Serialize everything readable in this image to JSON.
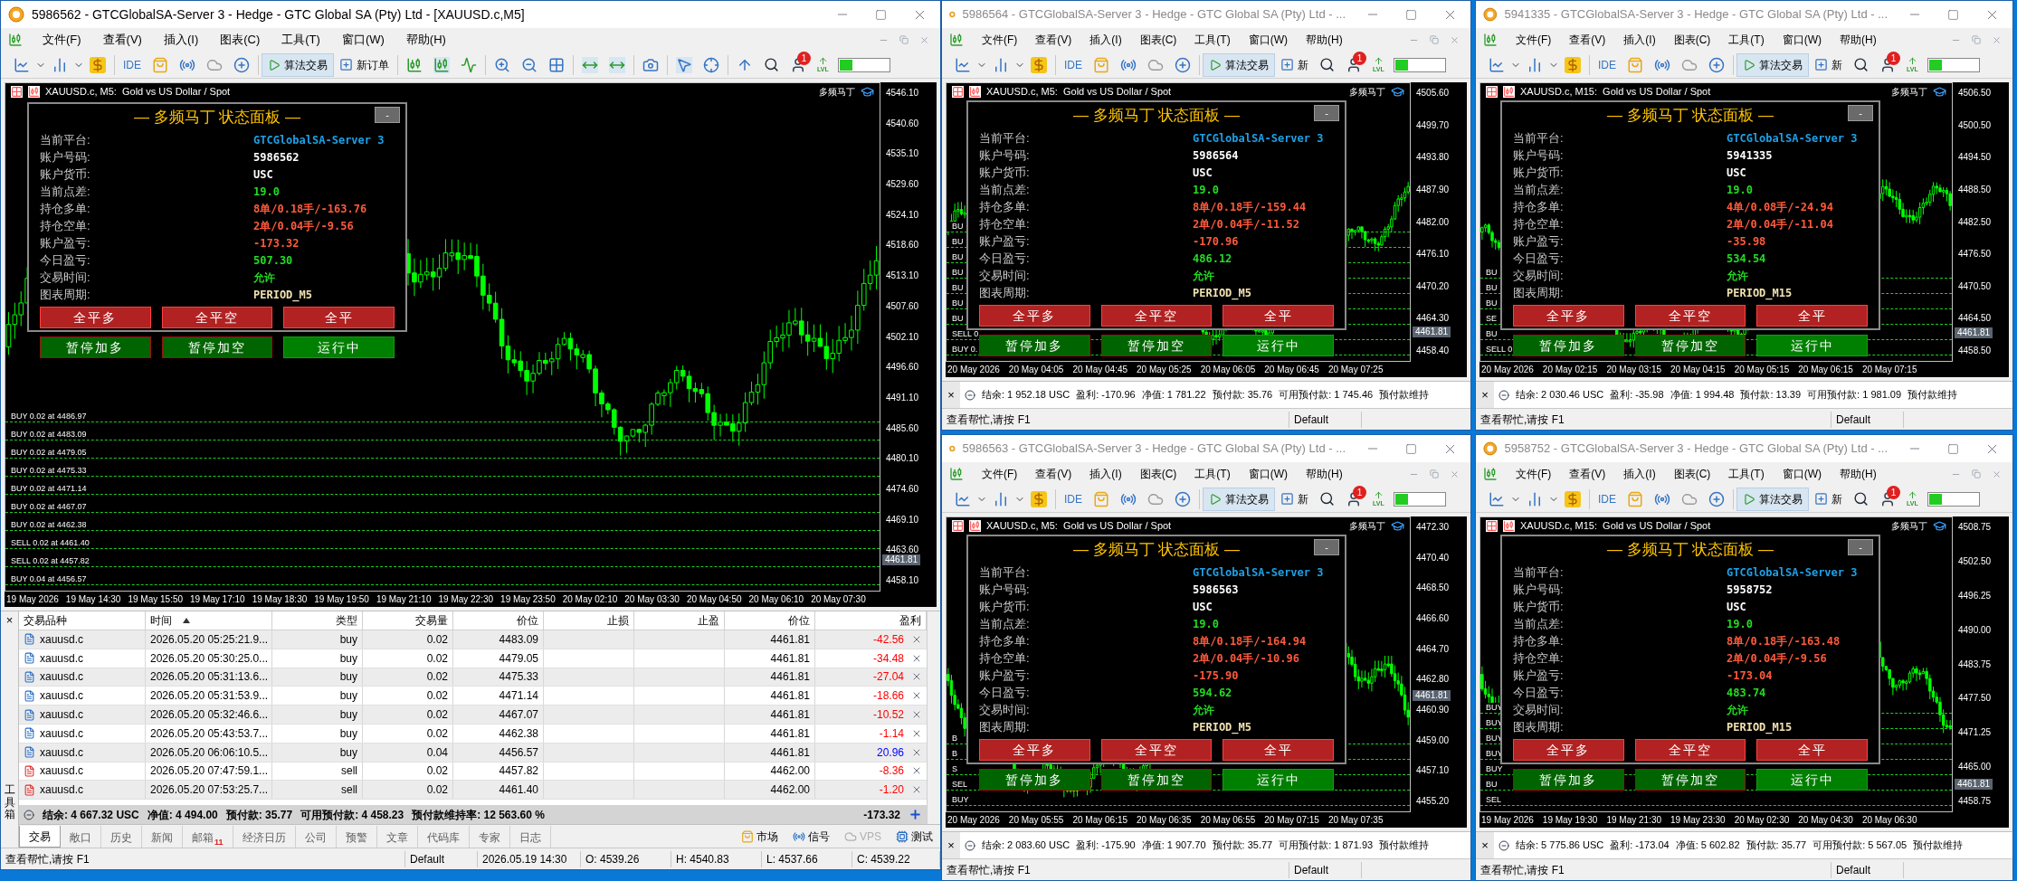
{
  "windows": [
    {
      "kind": "main",
      "active": true,
      "title": "5986562 - GTCGlobalSA-Server 3 - Hedge - GTC Global SA (Pty) Ltd - [XAUUSD.c,M5]",
      "menu": [
        "文件(F)",
        "查看(V)",
        "插入(I)",
        "图表(C)",
        "工具(T)",
        "窗口(W)",
        "帮助(H)"
      ],
      "toolbar": {
        "ide": "IDE",
        "algo_trading": {
          "label": "算法交易",
          "on": true
        },
        "new_order": "新订单",
        "badge": "1",
        "lvl": "LVL"
      },
      "chart": {
        "header": "XAUUSD.c, M5:  Gold vs US Dollar / Spot",
        "indicator": "多频马丁",
        "price_axis": [
          "4546.10",
          "4540.60",
          "4535.10",
          "4529.60",
          "4524.10",
          "4518.60",
          "4513.10",
          "4507.60",
          "4502.10",
          "4496.60",
          "4491.10",
          "4485.60",
          "4480.10",
          "4474.60",
          "4469.10",
          "4463.60",
          "4458.10"
        ],
        "current_price": "4461.81",
        "time_axis": [
          "19 May 2026",
          "19 May 14:30",
          "19 May 15:50",
          "19 May 17:10",
          "19 May 18:30",
          "19 May 19:50",
          "19 May 21:10",
          "19 May 22:30",
          "19 May 23:50",
          "20 May 02:10",
          "20 May 03:30",
          "20 May 04:50",
          "20 May 06:10",
          "20 May 07:30"
        ],
        "order_lines": [
          "BUY 0.02 at 4486.97",
          "BUY 0.02 at 4483.09",
          "BUY 0.02 at 4479.05",
          "BUY 0.02 at 4475.33",
          "BUY 0.02 at 4471.14",
          "BUY 0.02 at 4467.07",
          "BUY 0.02 at 4462.38",
          "SELL 0.02 at 4461.40",
          "SELL 0.02 at 4457.82",
          "BUY 0.04 at 4456.57"
        ],
        "panel": {
          "title": "— 多频马丁 状态面板 —",
          "minimize": "-",
          "rows": [
            {
              "label": "当前平台:",
              "value": "GTCGlobalSA-Server 3",
              "color": "#1ea0e6"
            },
            {
              "label": "账户号码:",
              "value": "5986562",
              "color": "#ffffff"
            },
            {
              "label": "账户货币:",
              "value": "USC",
              "color": "#ffffff"
            },
            {
              "label": "当前点差:",
              "value": "19.0",
              "color": "#22dd22"
            },
            {
              "label": "持仓多单:",
              "value": "8单/0.18手/-163.76",
              "color": "#ff5a3c"
            },
            {
              "label": "持仓空单:",
              "value": "2单/0.04手/-9.56",
              "color": "#ff5a3c"
            },
            {
              "label": "账户盈亏:",
              "value": "-173.32",
              "color": "#ff5a3c"
            },
            {
              "label": "今日盈亏:",
              "value": "507.30",
              "color": "#22dd22"
            },
            {
              "label": "交易时间:",
              "value": "允许",
              "color": "#22dd22"
            },
            {
              "label": "图表周期:",
              "value": "PERIOD_M5",
              "color": "#f2e2b0"
            }
          ],
          "buttons": [
            {
              "label": "全平多",
              "kind": "close"
            },
            {
              "label": "全平空",
              "kind": "close"
            },
            {
              "label": "全平",
              "kind": "close"
            },
            {
              "label": "暂停加多",
              "kind": "pause"
            },
            {
              "label": "暂停加空",
              "kind": "pause"
            },
            {
              "label": "运行中",
              "kind": "running"
            }
          ]
        }
      },
      "toolbox": {
        "side_label": "工具箱",
        "close": "×",
        "columns": [
          {
            "label": "交易品种",
            "sorted": false
          },
          {
            "label": "时间",
            "sorted": true
          },
          {
            "label": "类型",
            "sorted": false
          },
          {
            "label": "交易量",
            "sorted": false
          },
          {
            "label": "价位",
            "sorted": false
          },
          {
            "label": "止损",
            "sorted": false
          },
          {
            "label": "止盈",
            "sorted": false
          },
          {
            "label": "价位",
            "sorted": false
          },
          {
            "label": "盈利",
            "sorted": false
          }
        ],
        "rows": [
          {
            "kind": "buy",
            "cells": [
              "xauusd.c",
              "2026.05.20 05:25:21.9...",
              "buy",
              "0.02",
              "4483.09",
              "",
              "",
              "4461.81",
              "-42.56"
            ],
            "color": "#ff0000"
          },
          {
            "kind": "buy",
            "cells": [
              "xauusd.c",
              "2026.05.20 05:30:25.0...",
              "buy",
              "0.02",
              "4479.05",
              "",
              "",
              "4461.81",
              "-34.48"
            ],
            "color": "#ff0000"
          },
          {
            "kind": "buy",
            "cells": [
              "xauusd.c",
              "2026.05.20 05:31:13.6...",
              "buy",
              "0.02",
              "4475.33",
              "",
              "",
              "4461.81",
              "-27.04"
            ],
            "color": "#ff0000"
          },
          {
            "kind": "buy",
            "cells": [
              "xauusd.c",
              "2026.05.20 05:31:53.9...",
              "buy",
              "0.02",
              "4471.14",
              "",
              "",
              "4461.81",
              "-18.66"
            ],
            "color": "#ff0000"
          },
          {
            "kind": "buy",
            "cells": [
              "xauusd.c",
              "2026.05.20 05:32:46.6...",
              "buy",
              "0.02",
              "4467.07",
              "",
              "",
              "4461.81",
              "-10.52"
            ],
            "color": "#ff0000"
          },
          {
            "kind": "buy",
            "cells": [
              "xauusd.c",
              "2026.05.20 05:43:53.7...",
              "buy",
              "0.02",
              "4462.38",
              "",
              "",
              "4461.81",
              "-1.14"
            ],
            "color": "#ff0000"
          },
          {
            "kind": "buy",
            "cells": [
              "xauusd.c",
              "2026.05.20 06:06:10.5...",
              "buy",
              "0.04",
              "4456.57",
              "",
              "",
              "4461.81",
              "20.96"
            ],
            "color": "#0000ff"
          },
          {
            "kind": "sell",
            "cells": [
              "xauusd.c",
              "2026.05.20 07:47:59.1...",
              "sell",
              "0.02",
              "4457.82",
              "",
              "",
              "4462.00",
              "-8.36"
            ],
            "color": "#ff0000"
          },
          {
            "kind": "sell",
            "cells": [
              "xauusd.c",
              "2026.05.20 07:53:25.7...",
              "sell",
              "0.02",
              "4461.40",
              "",
              "",
              "4462.00",
              "-1.20"
            ],
            "color": "#ff0000"
          }
        ],
        "summary": [
          "结余: 4 667.32 USC",
          "净值: 4 494.00",
          "预付款: 35.77",
          "可用预付款: 4 458.23",
          "预付款维持率: 12 563.60 %"
        ],
        "total": "-173.32",
        "tabs": [
          {
            "label": "交易",
            "selected": true
          },
          {
            "label": "敞口",
            "selected": false
          },
          {
            "label": "历史",
            "selected": false
          },
          {
            "label": "新闻",
            "selected": false
          },
          {
            "label": "邮箱",
            "selected": false,
            "badge": "11"
          },
          {
            "label": "经济日历",
            "selected": false
          },
          {
            "label": "公司",
            "selected": false
          },
          {
            "label": "预警",
            "selected": false
          },
          {
            "label": "文章",
            "selected": false
          },
          {
            "label": "代码库",
            "selected": false
          },
          {
            "label": "专家",
            "selected": false
          },
          {
            "label": "日志",
            "selected": false
          }
        ],
        "services": [
          {
            "label": "市场",
            "kind": "market",
            "disabled": false
          },
          {
            "label": "信号",
            "kind": "signals",
            "disabled": false
          },
          {
            "label": "VPS",
            "kind": "vps",
            "disabled": true
          },
          {
            "label": "测试",
            "kind": "tester",
            "disabled": false
          }
        ]
      },
      "status_bar": [
        "查看帮忙,请按 F1",
        "Default",
        "2026.05.19 14:30",
        "O: 4539.26",
        "H: 4540.83",
        "L: 4537.66",
        "C: 4539.22"
      ]
    },
    {
      "kind": "compact",
      "active": false,
      "title": "5986564 - GTCGlobalSA-Server 3 - Hedge - GTC Global SA (Pty) Ltd - ...",
      "menu": [
        "文件(F)",
        "查看(V)",
        "插入(I)",
        "图表(C)",
        "工具(T)",
        "窗口(W)",
        "帮助(H)"
      ],
      "toolbar": {
        "ide": "IDE",
        "algo_trading": {
          "label": "算法交易",
          "on": true
        },
        "new_order": "新",
        "badge": "1",
        "lvl": "LVL"
      },
      "chart": {
        "header": "XAUUSD.c, M5:  Gold vs US Dollar / Spot",
        "indicator": "多频马丁",
        "price_axis": [
          "4505.60",
          "4499.70",
          "4493.80",
          "4487.90",
          "4482.00",
          "4476.10",
          "4470.20",
          "4464.30",
          "4458.40"
        ],
        "current_price": "4461.81",
        "time_axis": [
          "20 May 2026",
          "20 May 04:05",
          "20 May 04:45",
          "20 May 05:25",
          "20 May 06:05",
          "20 May 06:45",
          "20 May 07:25"
        ],
        "order_lines": [
          "BU",
          "BU",
          "BU",
          "BU",
          "BU",
          "BU",
          "BU",
          "SELL 0.",
          "BUY 0."
        ],
        "panel": {
          "title": "— 多频马丁 状态面板 —",
          "minimize": "-",
          "rows": [
            {
              "label": "当前平台:",
              "value": "GTCGlobalSA-Server 3",
              "color": "#1ea0e6"
            },
            {
              "label": "账户号码:",
              "value": "5986564",
              "color": "#ffffff"
            },
            {
              "label": "账户货币:",
              "value": "USC",
              "color": "#ffffff"
            },
            {
              "label": "当前点差:",
              "value": "19.0",
              "color": "#22dd22"
            },
            {
              "label": "持仓多单:",
              "value": "8单/0.18手/-159.44",
              "color": "#ff5a3c"
            },
            {
              "label": "持仓空单:",
              "value": "2单/0.04手/-11.52",
              "color": "#ff5a3c"
            },
            {
              "label": "账户盈亏:",
              "value": "-170.96",
              "color": "#ff5a3c"
            },
            {
              "label": "今日盈亏:",
              "value": "486.12",
              "color": "#22dd22"
            },
            {
              "label": "交易时间:",
              "value": "允许",
              "color": "#22dd22"
            },
            {
              "label": "图表周期:",
              "value": "PERIOD_M5",
              "color": "#f2e2b0"
            }
          ],
          "buttons": [
            {
              "label": "全平多",
              "kind": "close"
            },
            {
              "label": "全平空",
              "kind": "close"
            },
            {
              "label": "全平",
              "kind": "close"
            },
            {
              "label": "暂停加多",
              "kind": "pause"
            },
            {
              "label": "暂停加空",
              "kind": "pause"
            },
            {
              "label": "运行中",
              "kind": "running"
            }
          ]
        }
      },
      "toolbox": {
        "close": "×",
        "summary": [
          "结余: 1 952.18 USC",
          "盈利: -170.96",
          "净值: 1 781.22",
          "预付款: 35.76",
          "可用预付款: 1 745.46",
          "预付款维持"
        ]
      },
      "status_bar": [
        "查看帮忙,请按 F1",
        "Default"
      ]
    },
    {
      "kind": "compact",
      "active": false,
      "title": "5941335 - GTCGlobalSA-Server 3 - Hedge - GTC Global SA (Pty) Ltd - ...",
      "menu": [
        "文件(F)",
        "查看(V)",
        "插入(I)",
        "图表(C)",
        "工具(T)",
        "窗口(W)",
        "帮助(H)"
      ],
      "toolbar": {
        "ide": "IDE",
        "algo_trading": {
          "label": "算法交易",
          "on": true
        },
        "new_order": "新",
        "badge": "1",
        "lvl": "LVL"
      },
      "chart": {
        "header": "XAUUSD.c, M15:  Gold vs US Dollar / Spot",
        "indicator": "多频马丁",
        "price_axis": [
          "4506.50",
          "4500.50",
          "4494.50",
          "4488.50",
          "4482.50",
          "4476.50",
          "4470.50",
          "4464.50",
          "4458.50"
        ],
        "current_price": "4461.81",
        "time_axis": [
          "20 May 2026",
          "20 May 02:15",
          "20 May 03:15",
          "20 May 04:15",
          "20 May 05:15",
          "20 May 06:15",
          "20 May 07:15"
        ],
        "order_lines": [
          "BU",
          "BU",
          "BU",
          "SE",
          "BU",
          "SELL 0."
        ],
        "panel": {
          "title": "— 多频马丁 状态面板 —",
          "minimize": "-",
          "rows": [
            {
              "label": "当前平台:",
              "value": "GTCGlobalSA-Server 3",
              "color": "#1ea0e6"
            },
            {
              "label": "账户号码:",
              "value": "5941335",
              "color": "#ffffff"
            },
            {
              "label": "账户货币:",
              "value": "USC",
              "color": "#ffffff"
            },
            {
              "label": "当前点差:",
              "value": "19.0",
              "color": "#22dd22"
            },
            {
              "label": "持仓多单:",
              "value": "4单/0.08手/-24.94",
              "color": "#ff5a3c"
            },
            {
              "label": "持仓空单:",
              "value": "2单/0.04手/-11.04",
              "color": "#ff5a3c"
            },
            {
              "label": "账户盈亏:",
              "value": "-35.98",
              "color": "#ff5a3c"
            },
            {
              "label": "今日盈亏:",
              "value": "534.54",
              "color": "#22dd22"
            },
            {
              "label": "交易时间:",
              "value": "允许",
              "color": "#22dd22"
            },
            {
              "label": "图表周期:",
              "value": "PERIOD_M15",
              "color": "#f2e2b0"
            }
          ],
          "buttons": [
            {
              "label": "全平多",
              "kind": "close"
            },
            {
              "label": "全平空",
              "kind": "close"
            },
            {
              "label": "全平",
              "kind": "close"
            },
            {
              "label": "暂停加多",
              "kind": "pause"
            },
            {
              "label": "暂停加空",
              "kind": "pause"
            },
            {
              "label": "运行中",
              "kind": "running"
            }
          ]
        }
      },
      "toolbox": {
        "close": "×",
        "summary": [
          "结余: 2 030.46 USC",
          "盈利: -35.98",
          "净值: 1 994.48",
          "预付款: 13.39",
          "可用预付款: 1 981.09",
          "预付款维持"
        ]
      },
      "status_bar": [
        "查看帮忙,请按 F1",
        "Default"
      ]
    },
    {
      "kind": "compact",
      "active": false,
      "title": "5986563 - GTCGlobalSA-Server 3 - Hedge - GTC Global SA (Pty) Ltd - ...",
      "menu": [
        "文件(F)",
        "查看(V)",
        "插入(I)",
        "图表(C)",
        "工具(T)",
        "窗口(W)",
        "帮助(H)"
      ],
      "toolbar": {
        "ide": "IDE",
        "algo_trading": {
          "label": "算法交易",
          "on": true
        },
        "new_order": "新",
        "badge": "1",
        "lvl": "LVL"
      },
      "chart": {
        "header": "XAUUSD.c, M5:  Gold vs US Dollar / Spot",
        "indicator": "多频马丁",
        "price_axis": [
          "4472.30",
          "4470.40",
          "4468.50",
          "4466.60",
          "4464.70",
          "4462.80",
          "4460.90",
          "4459.00",
          "4457.10",
          "4455.20"
        ],
        "current_price": "4461.81",
        "time_axis": [
          "20 May 2026",
          "20 May 05:55",
          "20 May 06:15",
          "20 May 06:35",
          "20 May 06:55",
          "20 May 07:15",
          "20 May 07:35"
        ],
        "order_lines": [
          "B",
          "B",
          "S",
          "SEL",
          "BUY"
        ],
        "panel": {
          "title": "— 多频马丁 状态面板 —",
          "minimize": "-",
          "rows": [
            {
              "label": "当前平台:",
              "value": "GTCGlobalSA-Server 3",
              "color": "#1ea0e6"
            },
            {
              "label": "账户号码:",
              "value": "5986563",
              "color": "#ffffff"
            },
            {
              "label": "账户货币:",
              "value": "USC",
              "color": "#ffffff"
            },
            {
              "label": "当前点差:",
              "value": "19.0",
              "color": "#22dd22"
            },
            {
              "label": "持仓多单:",
              "value": "8单/0.18手/-164.94",
              "color": "#ff5a3c"
            },
            {
              "label": "持仓空单:",
              "value": "2单/0.04手/-10.96",
              "color": "#ff5a3c"
            },
            {
              "label": "账户盈亏:",
              "value": "-175.90",
              "color": "#ff5a3c"
            },
            {
              "label": "今日盈亏:",
              "value": "594.62",
              "color": "#22dd22"
            },
            {
              "label": "交易时间:",
              "value": "允许",
              "color": "#22dd22"
            },
            {
              "label": "图表周期:",
              "value": "PERIOD_M5",
              "color": "#f2e2b0"
            }
          ],
          "buttons": [
            {
              "label": "全平多",
              "kind": "close"
            },
            {
              "label": "全平空",
              "kind": "close"
            },
            {
              "label": "全平",
              "kind": "close"
            },
            {
              "label": "暂停加多",
              "kind": "pause"
            },
            {
              "label": "暂停加空",
              "kind": "pause"
            },
            {
              "label": "运行中",
              "kind": "running"
            }
          ]
        }
      },
      "toolbox": {
        "close": "×",
        "summary": [
          "结余: 2 083.60 USC",
          "盈利: -175.90",
          "净值: 1 907.70",
          "预付款: 35.77",
          "可用预付款: 1 871.93",
          "预付款维持"
        ]
      },
      "status_bar": [
        "查看帮忙,请按 F1",
        "Default"
      ]
    },
    {
      "kind": "compact",
      "active": false,
      "title": "5958752 - GTCGlobalSA-Server 3 - Hedge - GTC Global SA (Pty) Ltd - ...",
      "menu": [
        "文件(F)",
        "查看(V)",
        "插入(I)",
        "图表(C)",
        "工具(T)",
        "窗口(W)",
        "帮助(H)"
      ],
      "toolbar": {
        "ide": "IDE",
        "algo_trading": {
          "label": "算法交易",
          "on": true
        },
        "new_order": "新",
        "badge": "1",
        "lvl": "LVL"
      },
      "chart": {
        "header": "XAUUSD.c, M15:  Gold vs US Dollar / Spot",
        "indicator": "多频马丁",
        "price_axis": [
          "4508.75",
          "4502.50",
          "4496.25",
          "4490.00",
          "4483.75",
          "4477.50",
          "4471.25",
          "4465.00",
          "4458.75"
        ],
        "current_price": "4461.81",
        "time_axis": [
          "19 May 2026",
          "19 May 19:30",
          "19 May 21:30",
          "19 May 23:30",
          "20 May 02:30",
          "20 May 04:30",
          "20 May 06:30"
        ],
        "order_lines": [
          "BUY",
          "BUY",
          "BUY",
          "BUY",
          "BUY",
          "BU",
          "SEL"
        ],
        "panel": {
          "title": "— 多频马丁 状态面板 —",
          "minimize": "-",
          "rows": [
            {
              "label": "当前平台:",
              "value": "GTCGlobalSA-Server 3",
              "color": "#1ea0e6"
            },
            {
              "label": "账户号码:",
              "value": "5958752",
              "color": "#ffffff"
            },
            {
              "label": "账户货币:",
              "value": "USC",
              "color": "#ffffff"
            },
            {
              "label": "当前点差:",
              "value": "19.0",
              "color": "#22dd22"
            },
            {
              "label": "持仓多单:",
              "value": "8单/0.18手/-163.48",
              "color": "#ff5a3c"
            },
            {
              "label": "持仓空单:",
              "value": "2单/0.04手/-9.56",
              "color": "#ff5a3c"
            },
            {
              "label": "账户盈亏:",
              "value": "-173.04",
              "color": "#ff5a3c"
            },
            {
              "label": "今日盈亏:",
              "value": "483.74",
              "color": "#22dd22"
            },
            {
              "label": "交易时间:",
              "value": "允许",
              "color": "#22dd22"
            },
            {
              "label": "图表周期:",
              "value": "PERIOD_M15",
              "color": "#f2e2b0"
            }
          ],
          "buttons": [
            {
              "label": "全平多",
              "kind": "close"
            },
            {
              "label": "全平空",
              "kind": "close"
            },
            {
              "label": "全平",
              "kind": "close"
            },
            {
              "label": "暂停加多",
              "kind": "pause"
            },
            {
              "label": "暂停加空",
              "kind": "pause"
            },
            {
              "label": "运行中",
              "kind": "running"
            }
          ]
        }
      },
      "toolbox": {
        "close": "×",
        "summary": [
          "结余: 5 775.86 USC",
          "盈利: -173.04",
          "净值: 5 602.82",
          "预付款: 35.77",
          "可用预付款: 5 567.05",
          "预付款维持"
        ]
      },
      "status_bar": [
        "查看帮忙,请按 F1",
        "Default"
      ]
    }
  ]
}
